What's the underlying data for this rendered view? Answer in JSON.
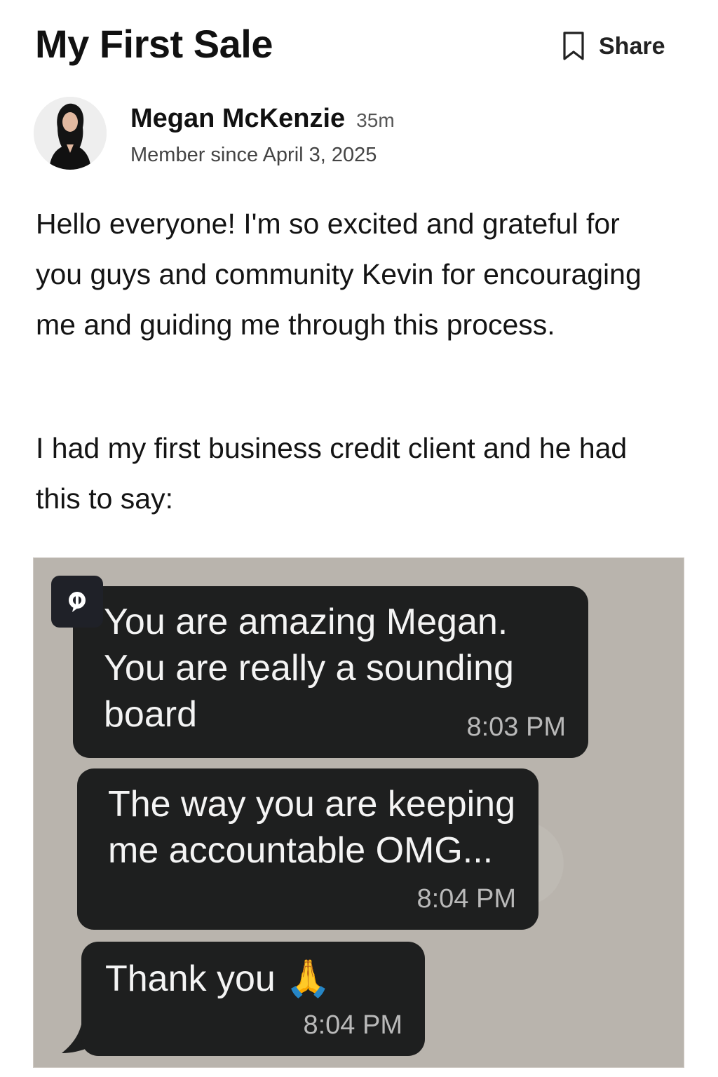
{
  "post": {
    "title": "My First Sale",
    "share_label": "Share",
    "author": {
      "name": "Megan McKenzie",
      "age": "35m",
      "member_since": "Member since April 3, 2025"
    },
    "body": [
      "Hello everyone! I'm so excited and grateful for you guys and community Kevin for encouraging me and guiding me through this process.",
      "I had my first business credit client and he had this to say:"
    ]
  },
  "attachment": {
    "messages": [
      {
        "text": "You are amazing Megan. You are really a sounding board",
        "time": "8:03 PM"
      },
      {
        "text": "The way you are keeping me accountable OMG...",
        "time": "8:04 PM"
      },
      {
        "text": "Thank you 🙏",
        "time": "8:04 PM"
      }
    ]
  },
  "icons": {
    "bookmark": "bookmark-icon",
    "app_badge": "chat-app-icon"
  },
  "colors": {
    "bubble": "#1e1f1f",
    "attachment_bg": "#b9b4ad",
    "text": "#111111"
  }
}
